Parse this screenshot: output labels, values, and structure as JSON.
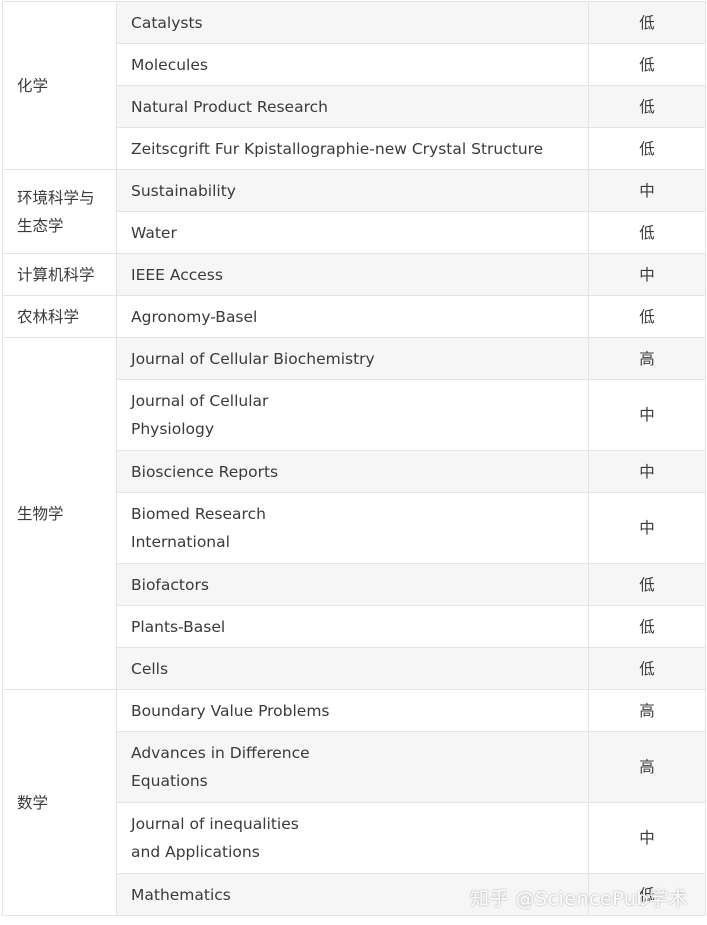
{
  "rows": [
    {
      "subject": "化学",
      "journal": "Catalysts",
      "level": "低"
    },
    {
      "journal": "Molecules",
      "level": "低"
    },
    {
      "journal": "Natural Product Research",
      "level": "低"
    },
    {
      "journal": "Zeitscgrift Fur Kpistallographie-new Crystal Structure",
      "level": "低"
    },
    {
      "subject": "环境科学与生态学",
      "journal": "Sustainability",
      "level": "中"
    },
    {
      "journal": "Water",
      "level": "低"
    },
    {
      "subject": "计算机科学",
      "journal": "IEEE Access",
      "level": "中"
    },
    {
      "subject": "农林科学",
      "journal": "Agronomy-Basel",
      "level": "低"
    },
    {
      "subject": "生物学",
      "journal": "Journal of Cellular Biochemistry",
      "level": "高"
    },
    {
      "journal": "Journal of Cellular Physiology",
      "level": "中"
    },
    {
      "journal": "Bioscience Reports",
      "level": "中"
    },
    {
      "journal": "Biomed Research International",
      "level": "中"
    },
    {
      "journal": "Biofactors",
      "level": "低"
    },
    {
      "journal": "Plants-Basel",
      "level": "低"
    },
    {
      "journal": "Cells",
      "level": "低"
    },
    {
      "subject": "数学",
      "journal": "Boundary Value Problems",
      "level": "高"
    },
    {
      "journal": "Advances in Difference Equations",
      "level": "高"
    },
    {
      "journal": "Journal of inequalities and Applications",
      "level": "中"
    },
    {
      "journal": "Mathematics",
      "level": "低"
    }
  ],
  "watermark": "知乎 @SciencePub学术"
}
